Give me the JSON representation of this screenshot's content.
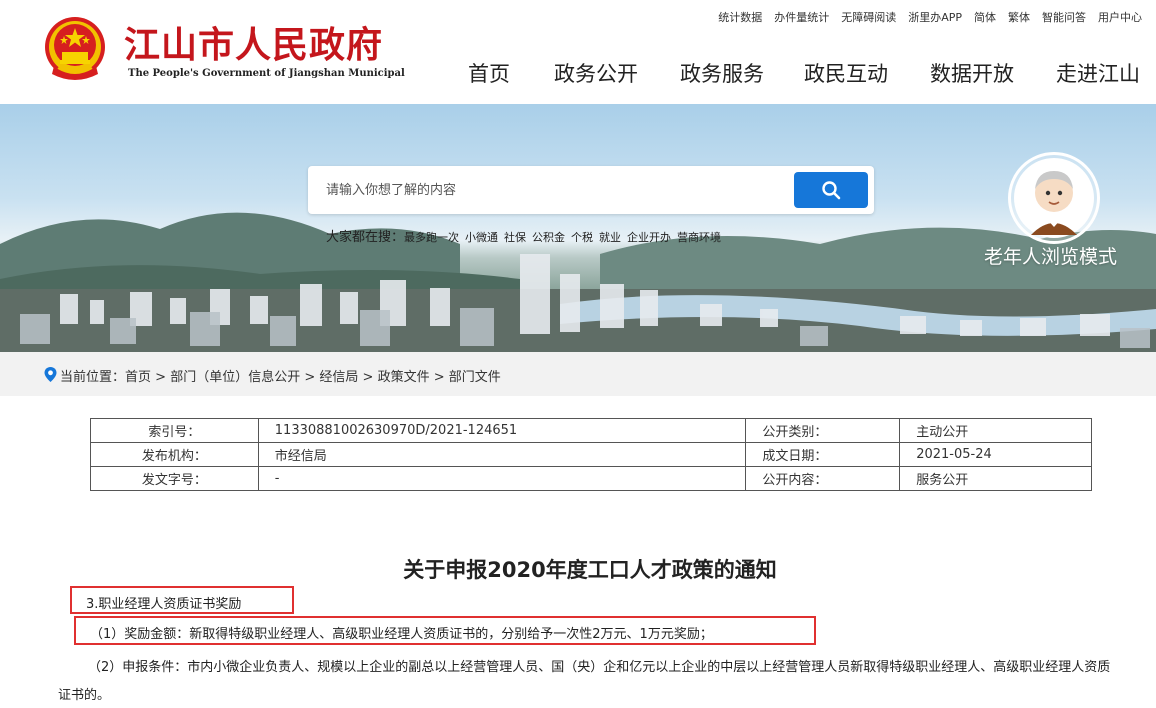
{
  "header": {
    "site_title": "江山市人民政府",
    "site_subtitle": "The People's Government of Jiangshan Municipal",
    "top_links": [
      "统计数据",
      "办件量统计",
      "无障碍阅读",
      "浙里办APP",
      "简体",
      "繁体",
      "智能问答",
      "用户中心"
    ],
    "nav": [
      "首页",
      "政务公开",
      "政务服务",
      "政民互动",
      "数据开放",
      "走进江山"
    ]
  },
  "search": {
    "placeholder": "请输入你想了解的内容",
    "hot_label": "大家都在搜：",
    "hot_items": [
      "最多跑一次",
      "小微通",
      "社保",
      "公积金",
      "个税",
      "就业",
      "企业开办",
      "营商环境"
    ]
  },
  "elder_mode": {
    "label": "老年人浏览模式"
  },
  "breadcrumb": {
    "prefix": "当前位置：",
    "items": [
      "首页",
      "部门（单位）信息公开",
      "经信局",
      "政策文件",
      "部门文件"
    ],
    "separator": " > "
  },
  "info_table": {
    "rows": [
      {
        "k1": "索引号：",
        "v1": "11330881002630970D/2021-124651",
        "k2": "公开类别：",
        "v2": "主动公开"
      },
      {
        "k1": "发布机构：",
        "v1": "市经信局",
        "k2": "成文日期：",
        "v2": "2021-05-24"
      },
      {
        "k1": "发文字号：",
        "v1": "-",
        "k2": "公开内容：",
        "v2": "服务公开"
      }
    ]
  },
  "article": {
    "title": "关于申报2020年度工口人才政策的通知",
    "p1": "3.职业经理人资质证书奖励",
    "p2": "（1）奖励金额：新取得特级职业经理人、高级职业经理人资质证书的，分别给予一次性2万元、1万元奖励；",
    "p3": "（2）申报条件：市内小微企业负责人、规模以上企业的副总以上经营管理人员、国（央）企和亿元以上企业的中层以上经营管理人员新取得特级职业经理人、高级职业经理人资质证书的。"
  },
  "colors": {
    "brand_red": "#c4161c",
    "search_blue": "#1677d9",
    "highlight_red": "#e03030"
  }
}
